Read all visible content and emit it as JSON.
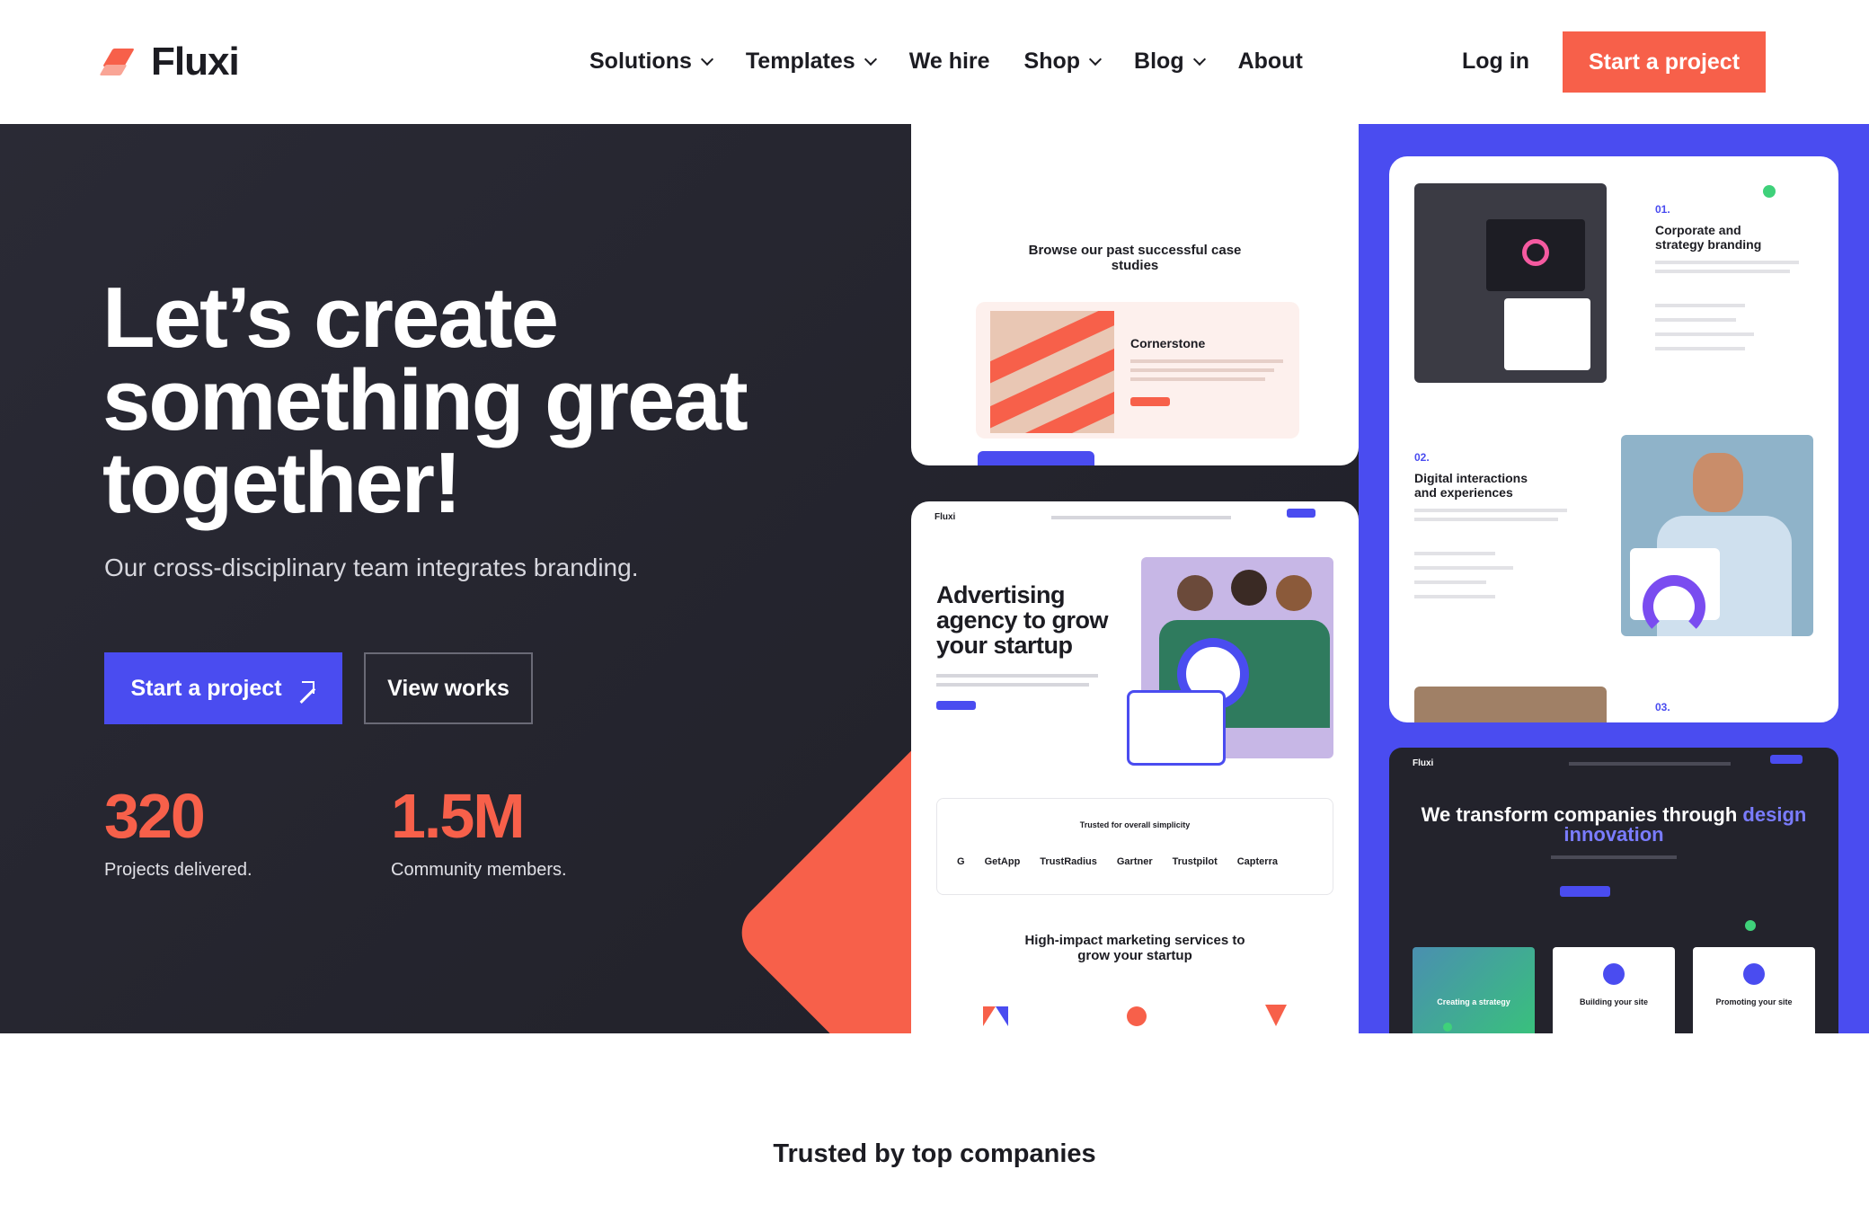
{
  "brand": {
    "name": "Fluxi"
  },
  "nav": {
    "items": [
      {
        "label": "Solutions",
        "dropdown": true
      },
      {
        "label": "Templates",
        "dropdown": true
      },
      {
        "label": "We hire",
        "dropdown": false
      },
      {
        "label": "Shop",
        "dropdown": true
      },
      {
        "label": "Blog",
        "dropdown": true
      },
      {
        "label": "About",
        "dropdown": false
      }
    ],
    "login": "Log in",
    "cta": "Start a project"
  },
  "hero": {
    "title": "Let’s create something great together!",
    "subtitle": "Our cross-disciplinary team integrates branding.",
    "primary_button": "Start a project",
    "secondary_button": "View works",
    "stats": [
      {
        "value": "320",
        "label": "Projects delivered."
      },
      {
        "value": "1.5M",
        "label": "Community members."
      }
    ]
  },
  "preview": {
    "case_studies": {
      "title": "Browse our past successful case studies",
      "card_title": "Cornerstone"
    },
    "advertising": {
      "brand": "Fluxi",
      "title": "Advertising agency to grow your startup",
      "trusted_label": "Trusted for overall simplicity",
      "logos": [
        "GetApp",
        "TrustRadius",
        "Gartner",
        "Trustpilot",
        "Capterra"
      ],
      "services_title": "High-impact marketing services to grow your startup"
    },
    "services": [
      {
        "num": "01.",
        "title": "Corporate and strategy branding"
      },
      {
        "num": "02.",
        "title": "Digital interactions and experiences"
      },
      {
        "num": "03.",
        "title": ""
      }
    ],
    "transform": {
      "brand": "Fluxi",
      "title_a": "We transform companies through",
      "title_b": "design innovation",
      "cards": [
        "Creating a strategy",
        "Building your site",
        "Promoting your site"
      ]
    }
  },
  "trusted": "Trusted by top companies",
  "colors": {
    "coral": "#f7604a",
    "blue": "#4a4cf0",
    "dark": "#23232c"
  }
}
